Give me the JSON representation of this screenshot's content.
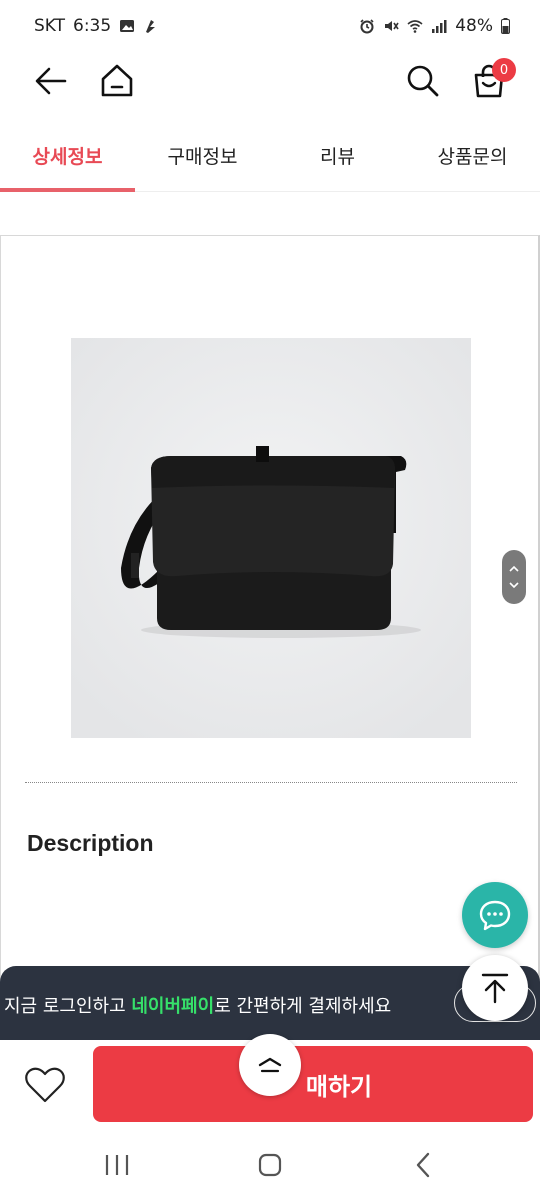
{
  "status_bar": {
    "carrier": "SKT",
    "time": "6:35",
    "battery": "48%"
  },
  "header": {
    "cart_count": "0"
  },
  "tabs": [
    {
      "label": "상세정보",
      "active": true
    },
    {
      "label": "구매정보",
      "active": false
    },
    {
      "label": "리뷰",
      "active": false
    },
    {
      "label": "상품문의",
      "active": false
    }
  ],
  "content": {
    "description_title": "Description"
  },
  "banner": {
    "text_before": "지금 로그인하고 ",
    "highlight": "네이버페이",
    "text_after": "로 간편하게 결제하세요"
  },
  "buy_bar": {
    "buy_label": "매하기"
  },
  "colors": {
    "accent": "#ec3b44",
    "tab_active": "#e84a55",
    "chat_fab": "#2ab5a8",
    "banner_bg": "#2c3340",
    "naver_green": "#36e06a"
  },
  "icons": {
    "back": "arrow-left-icon",
    "home": "home-icon",
    "search": "search-icon",
    "cart": "shopping-bag-icon",
    "chat": "chat-bubble-icon",
    "scroll_top": "arrow-up-bar-icon",
    "collapse": "chevron-up-icon",
    "wishlist": "heart-icon"
  }
}
